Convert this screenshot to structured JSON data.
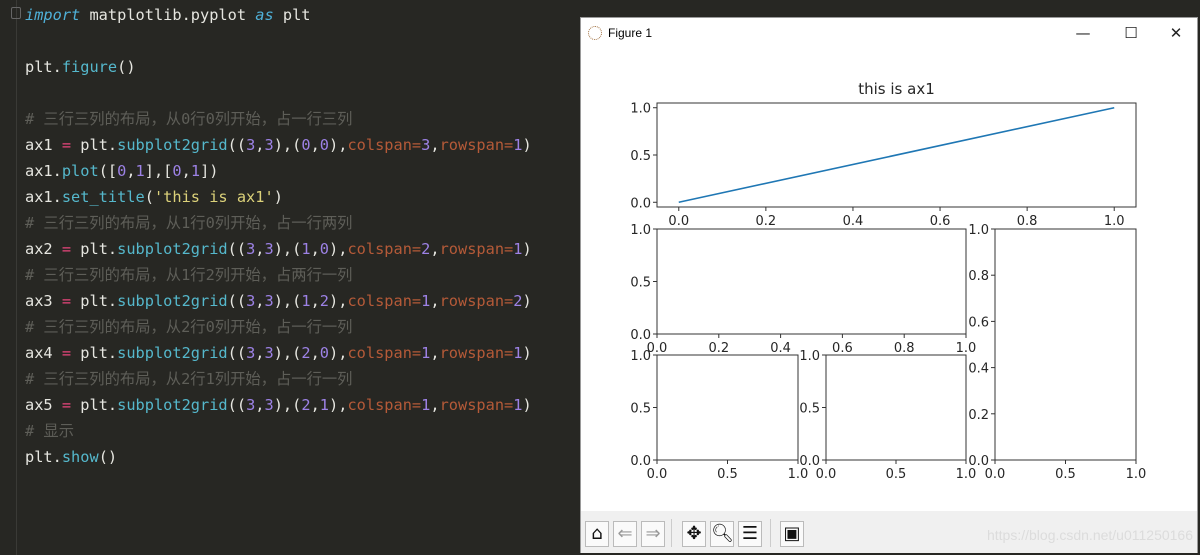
{
  "editor": {
    "lines": [
      [
        [
          "import",
          "kw"
        ],
        [
          " matplotlib.pyplot ",
          "plain"
        ],
        [
          "as",
          "kw"
        ],
        [
          " plt",
          "plain"
        ]
      ],
      [],
      [
        [
          "plt.",
          "plain"
        ],
        [
          "figure",
          "fn"
        ],
        [
          "()",
          "plain"
        ]
      ],
      [],
      [
        [
          "# 三行三列的布局，从0行0列开始，占一行三列",
          "cmt"
        ]
      ],
      [
        [
          "ax1 ",
          "plain"
        ],
        [
          "=",
          "op"
        ],
        [
          " plt.",
          "plain"
        ],
        [
          "subplot2grid",
          "fn"
        ],
        [
          "((",
          "plain"
        ],
        [
          "3",
          "num"
        ],
        [
          ",",
          "plain"
        ],
        [
          "3",
          "num"
        ],
        [
          "),(",
          "plain"
        ],
        [
          "0",
          "num"
        ],
        [
          ",",
          "plain"
        ],
        [
          "0",
          "num"
        ],
        [
          "),",
          "plain"
        ],
        [
          "colspan=",
          "kwarg"
        ],
        [
          "3",
          "num"
        ],
        [
          ",",
          "plain"
        ],
        [
          "rowspan=",
          "kwarg"
        ],
        [
          "1",
          "num"
        ],
        [
          ")",
          "plain"
        ]
      ],
      [
        [
          "ax1.",
          "plain"
        ],
        [
          "plot",
          "fn"
        ],
        [
          "([",
          "plain"
        ],
        [
          "0",
          "num"
        ],
        [
          ",",
          "plain"
        ],
        [
          "1",
          "num"
        ],
        [
          "],[",
          "plain"
        ],
        [
          "0",
          "num"
        ],
        [
          ",",
          "plain"
        ],
        [
          "1",
          "num"
        ],
        [
          "])",
          "plain"
        ]
      ],
      [
        [
          "ax1.",
          "plain"
        ],
        [
          "set_title",
          "fn"
        ],
        [
          "(",
          "plain"
        ],
        [
          "'this is ax1'",
          "str"
        ],
        [
          ")",
          "plain"
        ]
      ],
      [
        [
          "# 三行三列的布局，从1行0列开始，占一行两列",
          "cmt"
        ]
      ],
      [
        [
          "ax2 ",
          "plain"
        ],
        [
          "=",
          "op"
        ],
        [
          " plt.",
          "plain"
        ],
        [
          "subplot2grid",
          "fn"
        ],
        [
          "((",
          "plain"
        ],
        [
          "3",
          "num"
        ],
        [
          ",",
          "plain"
        ],
        [
          "3",
          "num"
        ],
        [
          "),(",
          "plain"
        ],
        [
          "1",
          "num"
        ],
        [
          ",",
          "plain"
        ],
        [
          "0",
          "num"
        ],
        [
          "),",
          "plain"
        ],
        [
          "colspan=",
          "kwarg"
        ],
        [
          "2",
          "num"
        ],
        [
          ",",
          "plain"
        ],
        [
          "rowspan=",
          "kwarg"
        ],
        [
          "1",
          "num"
        ],
        [
          ")",
          "plain"
        ]
      ],
      [
        [
          "# 三行三列的布局，从1行2列开始，占两行一列",
          "cmt"
        ]
      ],
      [
        [
          "ax3 ",
          "plain"
        ],
        [
          "=",
          "op"
        ],
        [
          " plt.",
          "plain"
        ],
        [
          "subplot2grid",
          "fn"
        ],
        [
          "((",
          "plain"
        ],
        [
          "3",
          "num"
        ],
        [
          ",",
          "plain"
        ],
        [
          "3",
          "num"
        ],
        [
          "),(",
          "plain"
        ],
        [
          "1",
          "num"
        ],
        [
          ",",
          "plain"
        ],
        [
          "2",
          "num"
        ],
        [
          "),",
          "plain"
        ],
        [
          "colspan=",
          "kwarg"
        ],
        [
          "1",
          "num"
        ],
        [
          ",",
          "plain"
        ],
        [
          "rowspan=",
          "kwarg"
        ],
        [
          "2",
          "num"
        ],
        [
          ")",
          "plain"
        ]
      ],
      [
        [
          "# 三行三列的布局，从2行0列开始，占一行一列",
          "cmt"
        ]
      ],
      [
        [
          "ax4 ",
          "plain"
        ],
        [
          "=",
          "op"
        ],
        [
          " plt.",
          "plain"
        ],
        [
          "subplot2grid",
          "fn"
        ],
        [
          "((",
          "plain"
        ],
        [
          "3",
          "num"
        ],
        [
          ",",
          "plain"
        ],
        [
          "3",
          "num"
        ],
        [
          "),(",
          "plain"
        ],
        [
          "2",
          "num"
        ],
        [
          ",",
          "plain"
        ],
        [
          "0",
          "num"
        ],
        [
          "),",
          "plain"
        ],
        [
          "colspan=",
          "kwarg"
        ],
        [
          "1",
          "num"
        ],
        [
          ",",
          "plain"
        ],
        [
          "rowspan=",
          "kwarg"
        ],
        [
          "1",
          "num"
        ],
        [
          ")",
          "plain"
        ]
      ],
      [
        [
          "# 三行三列的布局，从2行1列开始，占一行一列",
          "cmt"
        ]
      ],
      [
        [
          "ax5 ",
          "plain"
        ],
        [
          "=",
          "op"
        ],
        [
          " plt.",
          "plain"
        ],
        [
          "subplot2grid",
          "fn"
        ],
        [
          "((",
          "plain"
        ],
        [
          "3",
          "num"
        ],
        [
          ",",
          "plain"
        ],
        [
          "3",
          "num"
        ],
        [
          "),(",
          "plain"
        ],
        [
          "2",
          "num"
        ],
        [
          ",",
          "plain"
        ],
        [
          "1",
          "num"
        ],
        [
          "),",
          "plain"
        ],
        [
          "colspan=",
          "kwarg"
        ],
        [
          "1",
          "num"
        ],
        [
          ",",
          "plain"
        ],
        [
          "rowspan=",
          "kwarg"
        ],
        [
          "1",
          "num"
        ],
        [
          ")",
          "plain"
        ]
      ],
      [
        [
          "# 显示",
          "cmt"
        ]
      ],
      [
        [
          "plt.",
          "plain"
        ],
        [
          "show",
          "fn"
        ],
        [
          "()",
          "plain"
        ]
      ]
    ]
  },
  "window": {
    "title": "Figure 1",
    "minimize_label": "—",
    "maximize_label": "☐",
    "close_label": "✕",
    "toolbar": {
      "home": "home-icon",
      "back": "back-arrow-icon",
      "forward": "forward-arrow-icon",
      "pan": "pan-move-icon",
      "zoom": "zoom-magnifier-icon",
      "configure": "configure-subplots-icon",
      "save": "save-floppy-icon"
    },
    "watermark": "https://blog.csdn.net/u011250166"
  },
  "chart_data": [
    {
      "id": "ax1",
      "type": "line",
      "title": "this is ax1",
      "series": [
        {
          "x": [
            0,
            1
          ],
          "y": [
            0,
            1
          ],
          "color": "#1f77b4"
        }
      ],
      "xlim": [
        -0.05,
        1.05
      ],
      "ylim": [
        -0.05,
        1.05
      ],
      "xticks": [
        "0.0",
        "0.2",
        "0.4",
        "0.6",
        "0.8",
        "1.0"
      ],
      "yticks": [
        "0.0",
        "0.5",
        "1.0"
      ],
      "grid": false
    },
    {
      "id": "ax2",
      "type": "line",
      "title": "",
      "series": [],
      "xlim": [
        0,
        1
      ],
      "ylim": [
        0,
        1
      ],
      "xticks": [
        "0.0",
        "0.2",
        "0.4",
        "0.6",
        "0.8",
        "1.0"
      ],
      "yticks": [
        "0.0",
        "0.5",
        "1.0"
      ],
      "grid": false
    },
    {
      "id": "ax3",
      "type": "line",
      "title": "",
      "series": [],
      "xlim": [
        0,
        1
      ],
      "ylim": [
        0,
        1
      ],
      "xticks": [
        "0.0",
        "0.5",
        "1.0"
      ],
      "yticks": [
        "0.0",
        "0.2",
        "0.4",
        "0.6",
        "0.8",
        "1.0"
      ],
      "grid": false
    },
    {
      "id": "ax4",
      "type": "line",
      "title": "",
      "series": [],
      "xlim": [
        0,
        1
      ],
      "ylim": [
        0,
        1
      ],
      "xticks": [
        "0.0",
        "0.5",
        "1.0"
      ],
      "yticks": [
        "0.0",
        "0.5",
        "1.0"
      ],
      "grid": false
    },
    {
      "id": "ax5",
      "type": "line",
      "title": "",
      "series": [],
      "xlim": [
        0,
        1
      ],
      "ylim": [
        0,
        1
      ],
      "xticks": [
        "0.0",
        "0.5",
        "1.0"
      ],
      "yticks": [
        "0.0",
        "0.5",
        "1.0"
      ],
      "grid": false
    }
  ]
}
